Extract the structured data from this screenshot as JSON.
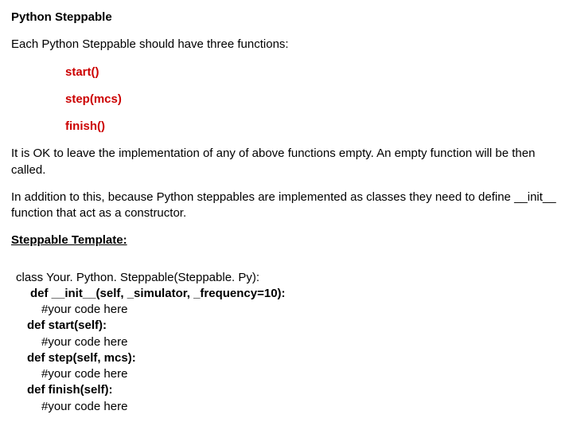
{
  "heading": "Python Steppable",
  "intro": "Each Python Steppable should have three functions:",
  "functions": {
    "f1": "start()",
    "f2": "step(mcs)",
    "f3": "finish()"
  },
  "para2": "It is OK to leave the implementation of any of above functions empty. An empty function will be then called.",
  "para3": "In addition to this, because Python steppables are implemented as classes they need to define __init__ function that act as a constructor.",
  "template_heading": "Steppable Template:",
  "code": {
    "l1": "class Your. Python. Steppable(Steppable. Py):",
    "l2": "def __init__(self, _simulator, _frequency=10):",
    "l3": "#your code here",
    "l4": "def start(self):",
    "l5": "#your code here",
    "l6": "def step(self, mcs):",
    "l7": "#your code here",
    "l8": "def finish(self):",
    "l9": "#your code here"
  }
}
